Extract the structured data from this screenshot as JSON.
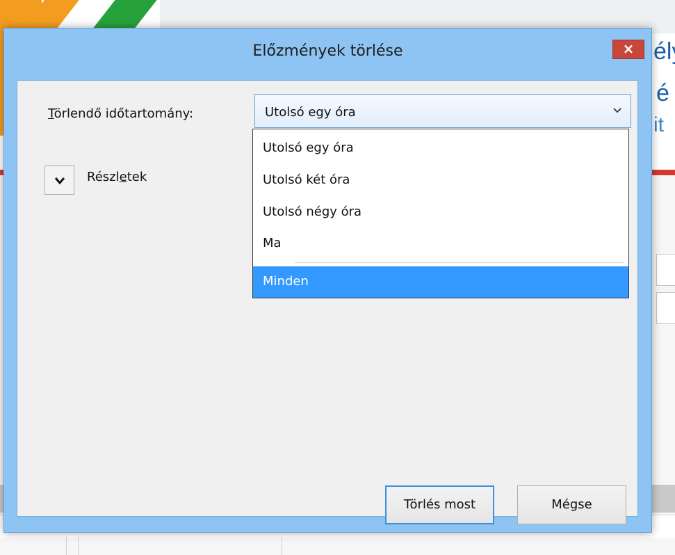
{
  "dialog": {
    "title": "Előzmények törlése",
    "close_glyph": "×"
  },
  "range": {
    "label_accesskey": "T",
    "label_rest": "örlendő időtartomány:",
    "selected": "Utolsó egy óra",
    "options": [
      "Utolsó egy óra",
      "Utolsó két óra",
      "Utolsó négy óra",
      "Ma",
      "Minden"
    ],
    "highlighted_option": "Minden"
  },
  "details": {
    "label_before": "Részl",
    "label_accesskey": "e",
    "label_after": "tek",
    "expand_icon": "chevron-down-icon"
  },
  "buttons": {
    "clear_now": "Törlés most",
    "cancel": "Mégse"
  },
  "background": {
    "text_1": "ély",
    "text_2": "é",
    "text_3": "it"
  },
  "colors": {
    "window_frame": "#8ec4f3",
    "close_button": "#c7483b",
    "highlight": "#3399ff",
    "focus_border": "#3c8fe0"
  }
}
